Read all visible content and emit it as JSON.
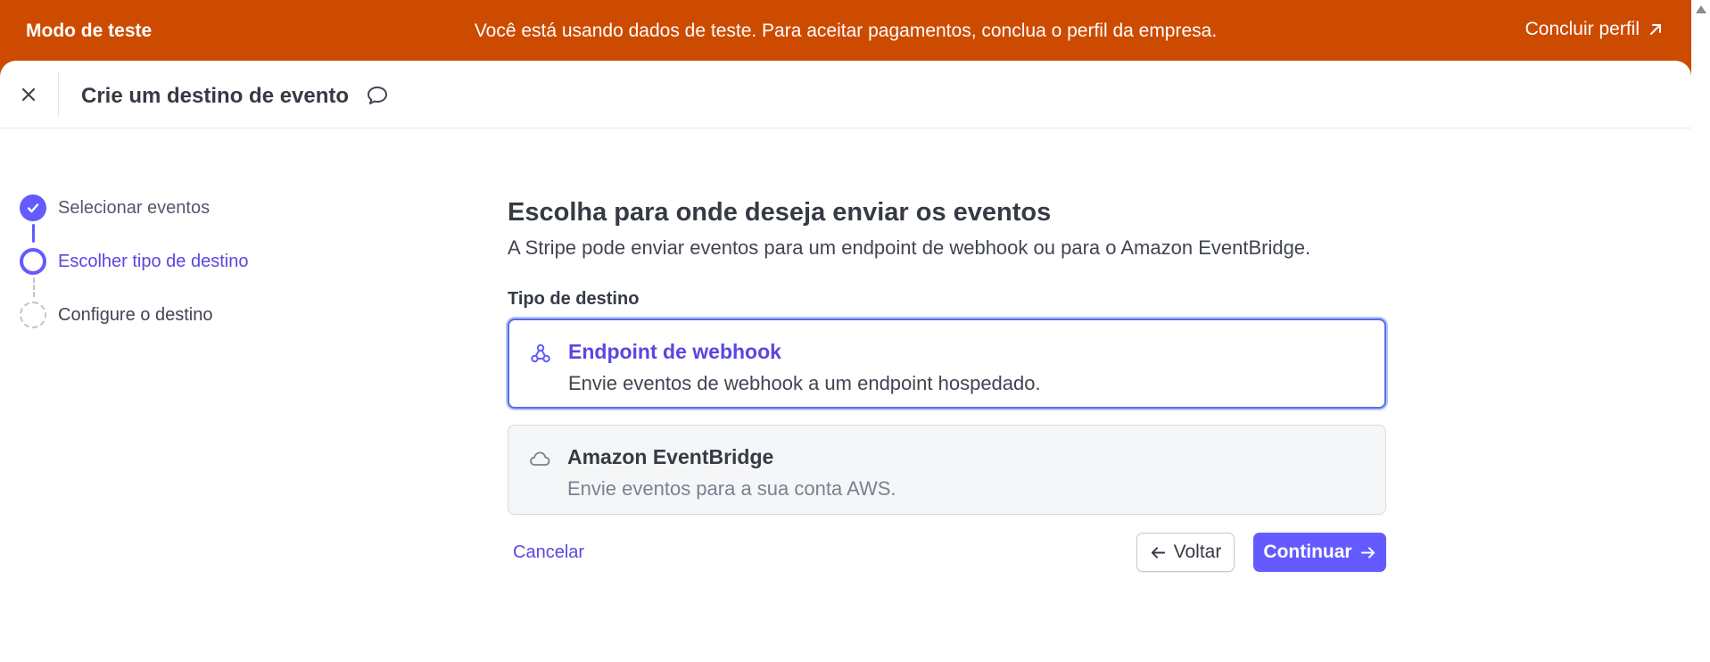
{
  "banner": {
    "mode_label": "Modo de teste",
    "message": "Você está usando dados de teste. Para aceitar pagamentos, conclua o perfil da empresa.",
    "action_label": "Concluir perfil",
    "action_icon": "arrow-up-right-icon"
  },
  "header": {
    "title": "Crie um destino de evento",
    "close_icon": "close-icon",
    "feedback_icon": "speech-bubble-icon"
  },
  "stepper": {
    "steps": [
      {
        "label": "Selecionar eventos",
        "status": "completed"
      },
      {
        "label": "Escolher tipo de destino",
        "status": "active"
      },
      {
        "label": "Configure o destino",
        "status": "pending"
      }
    ]
  },
  "main": {
    "title": "Escolha para onde deseja enviar os eventos",
    "subtitle": "A Stripe pode enviar eventos para um endpoint de webhook ou para o Amazon EventBridge.",
    "field_label": "Tipo de destino",
    "options": [
      {
        "title": "Endpoint de webhook",
        "description": "Envie eventos de webhook a um endpoint hospedado.",
        "icon": "webhook-icon",
        "selected": true
      },
      {
        "title": "Amazon EventBridge",
        "description": "Envie eventos para a sua conta AWS.",
        "icon": "cloud-icon",
        "selected": false
      }
    ]
  },
  "footer": {
    "cancel_label": "Cancelar",
    "back_label": "Voltar",
    "continue_label": "Continuar"
  },
  "colors": {
    "banner": "#cc4b00",
    "accent": "#635bff",
    "accent_text": "#5847e0",
    "selected_border": "#5a6be8"
  }
}
